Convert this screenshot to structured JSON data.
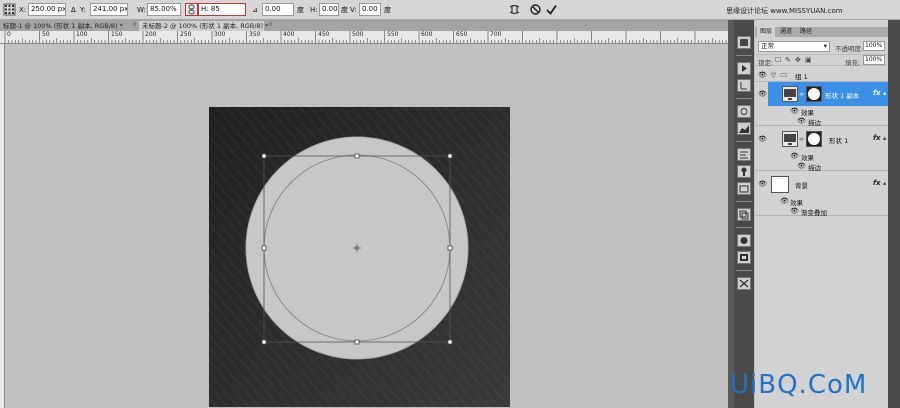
{
  "options": {
    "x_label": "X:",
    "x_value": "250.00 px",
    "y_label": "Y:",
    "y_value": "241.00 px",
    "w_label": "W:",
    "w_value": "85.00%",
    "h_label": "H:",
    "h_value": "85",
    "angle_value": "0.00",
    "angle_unit": "度",
    "hskew_label": "H:",
    "hskew_value": "0.00",
    "hskew_unit": "度",
    "vskew_label": "V:",
    "vskew_value": "0.00",
    "vskew_unit": "度"
  },
  "tabs": [
    {
      "label": "标题-1 @ 100% (形状 1 副本, RGB/8) *",
      "active": false
    },
    {
      "label": "未标题-2 @ 100% (形状 1 副本, RGB/8) *",
      "active": true
    }
  ],
  "tab_close": "×",
  "ruler": {
    "labels": [
      "0",
      "50",
      "100",
      "150",
      "200",
      "250",
      "300",
      "350",
      "400",
      "450",
      "500",
      "550",
      "600",
      "650",
      "700"
    ]
  },
  "watermark_top": "思缘设计论坛 www.MISSYUAN.com",
  "watermark_bottom": "UiBQ.CoM",
  "panel": {
    "tabs": [
      {
        "label": "图层",
        "active": true
      },
      {
        "label": "通道",
        "active": false
      },
      {
        "label": "路径",
        "active": false
      }
    ],
    "blend_mode": "正常",
    "opacity_label": "不透明度:",
    "opacity_value": "100%",
    "lock_label": "锁定:",
    "fill_label": "填充:",
    "fill_value": "100%",
    "group_name": "组 1",
    "layers": [
      {
        "name": "形状 1 副本",
        "selected": true,
        "fx": "fx",
        "effects_label": "效果",
        "effect": "描边"
      },
      {
        "name": "形状 1",
        "selected": false,
        "fx": "fx",
        "effects_label": "效果",
        "effect": "描边"
      },
      {
        "name": "背景",
        "selected": false,
        "fx": "fx",
        "effects_label": "效果",
        "effect": "渐变叠加"
      }
    ]
  },
  "colors": {
    "canvas_dark": "#262626",
    "circle_fill": "#c8c7c8",
    "selection_blue": "#3b8fe6",
    "watermark_blue": "#1e73c8"
  }
}
